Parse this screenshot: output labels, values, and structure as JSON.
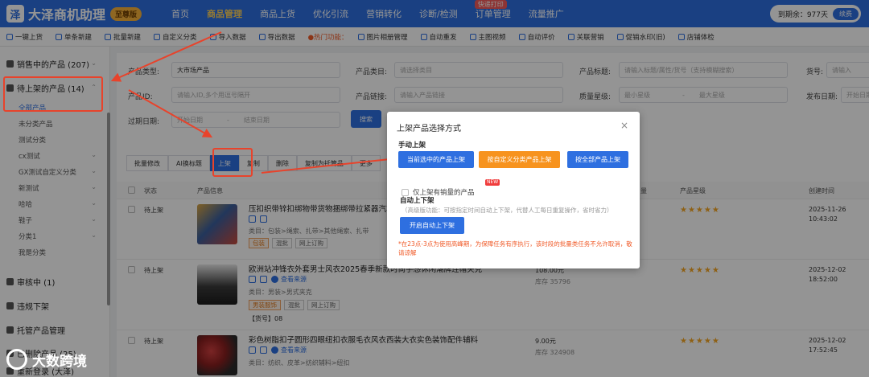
{
  "app": {
    "logo_mark": "泽",
    "title": "大泽商机助理",
    "edition": "至尊版"
  },
  "nav": [
    {
      "label": "首页"
    },
    {
      "label": "商品管理",
      "active": true
    },
    {
      "label": "商品上货"
    },
    {
      "label": "优化引流"
    },
    {
      "label": "营销转化"
    },
    {
      "label": "诊断/检测"
    },
    {
      "label": "订单管理",
      "tag": "快递打印"
    },
    {
      "label": "流量推广"
    }
  ],
  "account": {
    "expiry": "到期余：977天",
    "renew": "续费"
  },
  "toolbar": {
    "items": [
      "一键上货",
      "单条新建",
      "批量新建",
      "自定义分类",
      "导入数据",
      "导出数据"
    ],
    "hot": "●热门功能：",
    "hot_items": [
      "图片相册管理",
      "自动重发",
      "主图视频",
      "自动评价",
      "关联营销",
      "促销水印(旧)",
      "店铺体检"
    ]
  },
  "sidebar": {
    "on_sale": "销售中的产品 (207)",
    "pending": "待上架的产品 (14)",
    "sub_items": [
      "全部产品",
      "未分类产品",
      "测试分类",
      "cx测试",
      "GX测试自定义分类",
      "新测试",
      "哈哈",
      "鞋子",
      "分类1",
      "我是分类"
    ],
    "reviewing": "审核中 (1)",
    "violation": "违规下架",
    "hosted": "托管产品管理",
    "extra1": "已删除产品 (25)",
    "extra2": "重新登录 (大泽)"
  },
  "filters": {
    "product_type_label": "产品类型:",
    "product_type_value": "大市场产品",
    "category_label": "产品类目:",
    "category_ph": "请选择类目",
    "title_label": "产品标题:",
    "title_ph": "请输入标题/属性/货号（支持模糊搜索）",
    "item_no_label": "货号:",
    "item_no_ph": "请输入",
    "id_label": "产品ID:",
    "id_ph": "请输入ID,多个用逗号隔开",
    "link_label": "产品链接:",
    "link_ph": "请输入产品链接",
    "quality_label": "质量星级:",
    "quality_min": "最小星级",
    "quality_sep": "-",
    "quality_max": "最大星级",
    "publish_label": "发布日期:",
    "publish_ph": "开始日期",
    "expire_label": "过期日期:",
    "expire_start": "开始日期",
    "expire_sep": "-",
    "expire_end": "结束日期",
    "search": "搜索"
  },
  "actions": [
    "批量修改",
    "AI换标题",
    "上架",
    "复制",
    "删除",
    "复制为托管品",
    "更多"
  ],
  "table": {
    "headers": {
      "status": "状态",
      "info": "产品信息",
      "stock": "量",
      "stars": "产品星级",
      "created": "创建时间"
    },
    "rows": [
      {
        "status": "待上架",
        "title": "压扣织带锌扣绑物带货物捆绑带拉紧器汽车行李",
        "category": "类目：包装>绳索、扎带>其他绳索、扎带",
        "tags": [
          "包装",
          "混批",
          "网上订购"
        ],
        "stars": "★★★★★",
        "date": "2025-11-26",
        "time": "10:43:02"
      },
      {
        "status": "待上架",
        "title": "欧洲站冲锋衣外套男士风衣2025春季新款时尚手感休闲潮牌连帽夹克",
        "see_source": "查看来源",
        "category": "类目：男装>男式夹克",
        "tags": [
          "男装服饰",
          "混批",
          "网上订购"
        ],
        "price": "108.00元",
        "stock": "库存 35796",
        "item_no": "【货号】08",
        "stars": "★★★★★",
        "date": "2025-12-02",
        "time": "18:52:00"
      },
      {
        "status": "待上架",
        "title": "彩色树脂扣子圆形四眼纽扣衣服毛衣风衣西装大衣实色装饰配件辅料",
        "see_source": "查看来源",
        "category": "类目：纺织、皮革>纺织辅料>纽扣",
        "price": "9.00元",
        "stock": "库存 324908",
        "stars": "★★★★★",
        "date": "2025-12-02",
        "time": "17:52:45"
      }
    ]
  },
  "modal": {
    "title": "上架产品选择方式",
    "close": "×",
    "manual_label": "手动上架",
    "btn_selected": "当前选中的产品上架",
    "btn_custom": "按自定义分类产品上架",
    "btn_all": "按全部产品上架",
    "checkbox_label": "仅上架有销量的产品",
    "new_tag": "NEW",
    "auto_label": "自动上下架",
    "auto_desc": "（高级版功能：可按指定时间自动上下架，代替人工每日重复操作，省时省力）",
    "btn_auto": "开启自动上下架",
    "warning": "*在23点-3点为使用高峰期，为保障任务有序执行，该时段的批量类任务不允许取消，敬请谅解"
  },
  "colors": {
    "primary": "#2e6fe0",
    "orange": "#f7931e",
    "highlight": "#e8432b"
  },
  "watermark": "大数跨境"
}
